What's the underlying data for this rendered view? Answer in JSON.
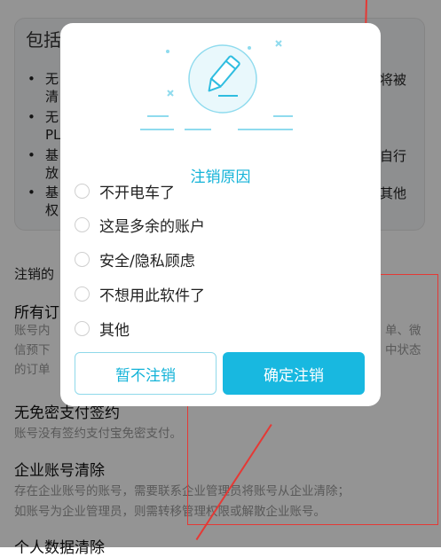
{
  "background": {
    "card_title": "包括",
    "bullets": [
      {
        "left": "无",
        "right": "将被"
      },
      {
        "left": "清",
        "right": ""
      },
      {
        "left": "无",
        "right": ""
      },
      {
        "left": "PL",
        "right": ""
      },
      {
        "left": "基",
        "right": "自行"
      },
      {
        "left": "放",
        "right": ""
      },
      {
        "left": "基",
        "right": "其他"
      },
      {
        "left": "权",
        "right": ""
      }
    ],
    "section_label": "注销的",
    "section1_title": "所有订",
    "section1_lines": [
      "账号内",
      "信预下",
      "的订单"
    ],
    "section1_right": [
      "单、微",
      "中状态"
    ],
    "section2_title": "无免密支付签约",
    "section2_desc": "账号没有签约支付宝免密支付。",
    "section3_title": "企业账号清除",
    "section3_desc_1": "存在企业账号的账号，需要联系企业管理员将账号从企业清除；",
    "section3_desc_2": "如账号为企业管理员，则需转移管理权限或解散企业账号。",
    "section4_title": "个人数据清除"
  },
  "dialog": {
    "title": "注销原因",
    "options": [
      {
        "label": "不开电车了",
        "selected": false
      },
      {
        "label": "这是多余的账户",
        "selected": false
      },
      {
        "label": "安全/隐私顾虑",
        "selected": false
      },
      {
        "label": "不想用此软件了",
        "selected": false
      },
      {
        "label": "其他",
        "selected": false
      }
    ],
    "cancel_label": "暂不注销",
    "confirm_label": "确定注销",
    "illustration_icon": "pencil-edit-icon"
  },
  "colors": {
    "accent": "#18b8e0",
    "overlay": "rgba(0,0,0,0.42)",
    "annotation": "#e53935"
  }
}
